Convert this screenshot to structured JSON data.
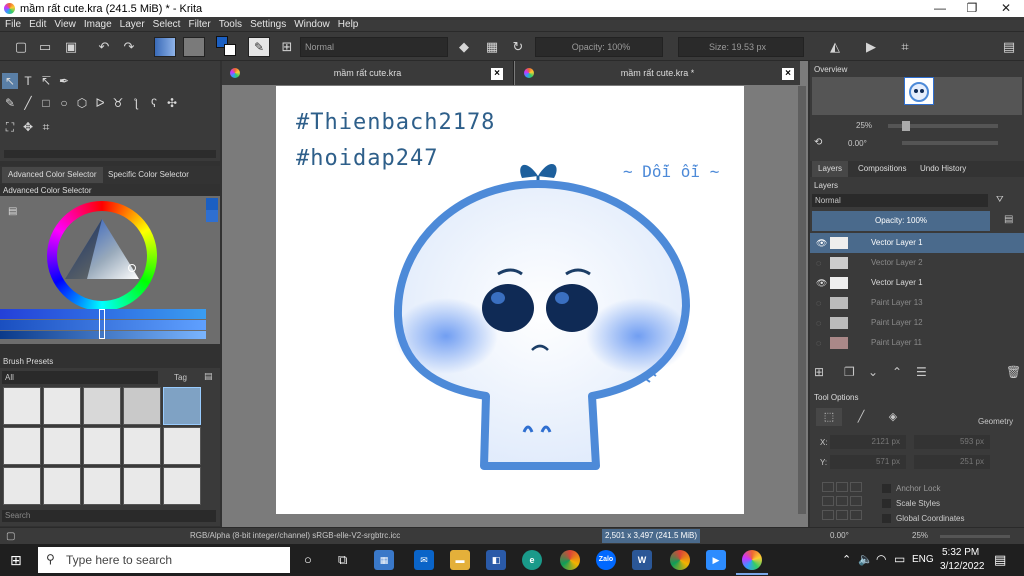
{
  "window": {
    "title": "mầm rất cute.kra (241.5 MiB)  * - Krita",
    "minimize": "—",
    "maximize": "❐",
    "close": "✕"
  },
  "menu": [
    "File",
    "Edit",
    "View",
    "Image",
    "Layer",
    "Select",
    "Filter",
    "Tools",
    "Settings",
    "Window",
    "Help"
  ],
  "toolbar": {
    "blend_mode": "Normal",
    "opacity": "Opacity: 100%",
    "size": "Size: 19.53 px"
  },
  "docker_left": {
    "tabs": [
      "Advanced Color Selector",
      "Specific Color Selector"
    ],
    "color_selector_title": "Advanced Color Selector",
    "brush_presets_title": "Brush Presets",
    "preset_filter": "All",
    "tag_label": "Tag",
    "search_placeholder": "Search"
  },
  "documents": [
    {
      "title": "mầm rất cute.kra"
    },
    {
      "title": "mầm rất cute.kra *"
    }
  ],
  "artwork": {
    "line1": "#Thienbach2178",
    "line2": "#hoidap247",
    "caption": "~ Dỗi ỗi ~"
  },
  "overview": {
    "title": "Overview",
    "zoom": "25%",
    "rotation": "0.00°"
  },
  "layers_panel": {
    "tabs": [
      "Layers",
      "Compositions",
      "Undo History"
    ],
    "title": "Layers",
    "blend_mode": "Normal",
    "opacity": "Opacity:  100%",
    "rows": [
      {
        "name": "Vector Layer 1",
        "selected": true,
        "visible": true
      },
      {
        "name": "Vector Layer 2",
        "selected": false,
        "visible": false
      },
      {
        "name": "Vector Layer 1",
        "selected": false,
        "visible": true
      },
      {
        "name": "Paint Layer 13",
        "selected": false,
        "visible": false
      },
      {
        "name": "Paint Layer 12",
        "selected": false,
        "visible": false
      },
      {
        "name": "Paint Layer 11",
        "selected": false,
        "visible": false
      }
    ]
  },
  "tool_options": {
    "title": "Tool Options",
    "geometry": "Geometry",
    "x_label": "X:",
    "y_label": "Y:",
    "x": "2121 px",
    "w": "593 px",
    "y": "571 px",
    "h": "251 px",
    "anchor_lock": "Anchor Lock",
    "scale_styles": "Scale Styles",
    "global_coords": "Global Coordinates"
  },
  "status": {
    "color_info": "RGB/Alpha (8-bit integer/channel)  sRGB-elle-V2-srgbtrc.icc",
    "dimensions": "2,501 x 3,497 (241.5 MiB)",
    "rotation": "0.00°",
    "zoom": "25%"
  },
  "taskbar": {
    "search_placeholder": "Type here to search",
    "language": "ENG",
    "time": "5:32 PM",
    "date": "3/12/2022",
    "zalo_label": "Zalo",
    "word_label": "W"
  },
  "colors": {
    "accent_blue": "#4d8ad8",
    "selected_layer": "#4a6a8c"
  }
}
